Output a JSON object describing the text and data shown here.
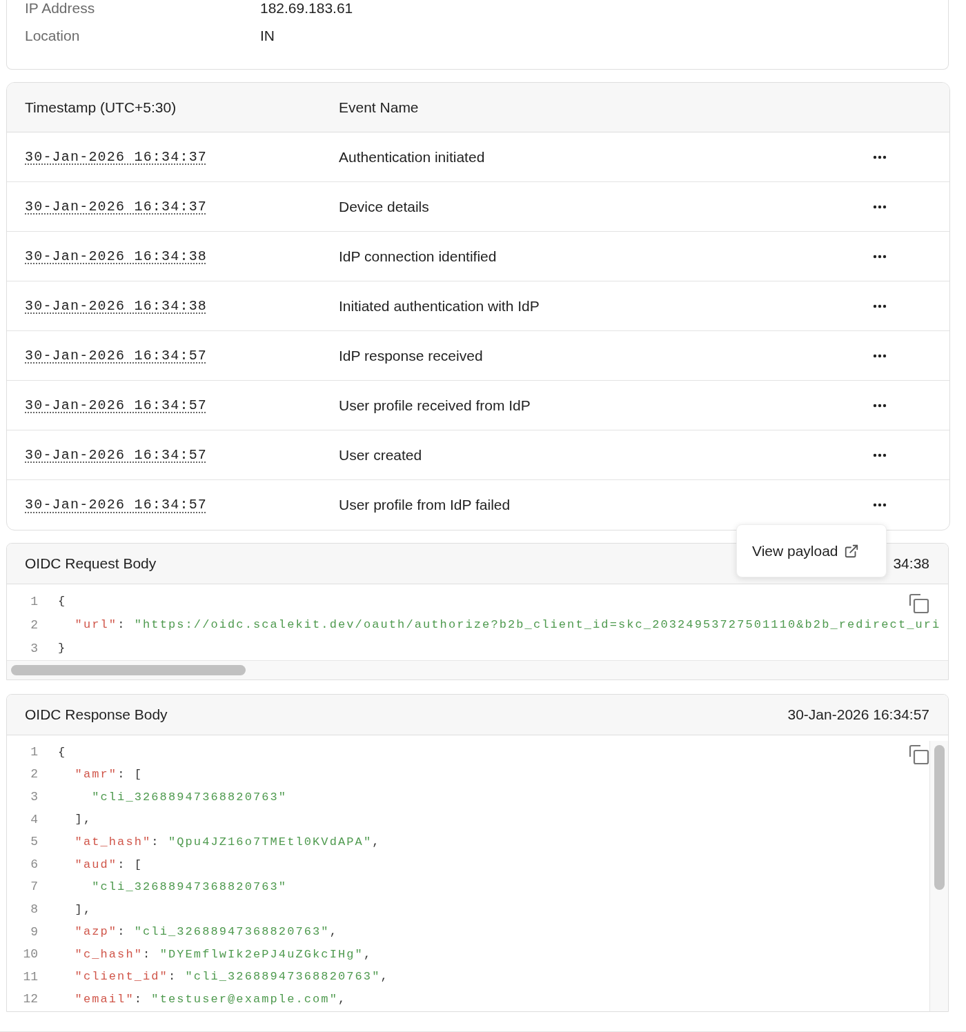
{
  "device_details": {
    "rows": [
      {
        "label": "IP Address",
        "value": "182.69.183.61"
      },
      {
        "label": "Location",
        "value": "IN"
      }
    ]
  },
  "events": {
    "columns": [
      "Timestamp (UTC+5:30)",
      "Event Name"
    ],
    "rows": [
      {
        "timestamp": "30-Jan-2026 16:34:37",
        "event": "Authentication initiated"
      },
      {
        "timestamp": "30-Jan-2026 16:34:37",
        "event": "Device details"
      },
      {
        "timestamp": "30-Jan-2026 16:34:38",
        "event": "IdP connection identified"
      },
      {
        "timestamp": "30-Jan-2026 16:34:38",
        "event": "Initiated authentication with IdP"
      },
      {
        "timestamp": "30-Jan-2026 16:34:57",
        "event": "IdP response received"
      },
      {
        "timestamp": "30-Jan-2026 16:34:57",
        "event": "User profile received from IdP"
      },
      {
        "timestamp": "30-Jan-2026 16:34:57",
        "event": "User created"
      },
      {
        "timestamp": "30-Jan-2026 16:34:57",
        "event": "User profile from IdP failed"
      }
    ]
  },
  "payload_menu": {
    "item": "View payload"
  },
  "request_body": {
    "title": "OIDC Request Body",
    "timestamp": "34:38",
    "lines": [
      {
        "number": "1",
        "tokens": [
          {
            "kind": "punct",
            "text": "{"
          }
        ]
      },
      {
        "number": "2",
        "tokens": [
          {
            "kind": "key",
            "text": "  \"url\""
          },
          {
            "kind": "punct",
            "text": ": "
          },
          {
            "kind": "string",
            "text": "\"https://oidc.scalekit.dev/oauth/authorize?b2b_client_id=skc_20324953727501110&b2b_redirect_uri"
          }
        ]
      },
      {
        "number": "3",
        "tokens": [
          {
            "kind": "punct",
            "text": "}"
          }
        ]
      }
    ]
  },
  "response_body": {
    "title": "OIDC Response Body",
    "timestamp": "30-Jan-2026 16:34:57",
    "lines": [
      {
        "number": "1",
        "tokens": [
          {
            "kind": "punct",
            "text": "{"
          }
        ]
      },
      {
        "number": "2",
        "tokens": [
          {
            "kind": "key",
            "text": "  \"amr\""
          },
          {
            "kind": "punct",
            "text": ": ["
          }
        ]
      },
      {
        "number": "3",
        "tokens": [
          {
            "kind": "string",
            "text": "    \"cli_32688947368820763\""
          }
        ]
      },
      {
        "number": "4",
        "tokens": [
          {
            "kind": "punct",
            "text": "  ],"
          }
        ]
      },
      {
        "number": "5",
        "tokens": [
          {
            "kind": "key",
            "text": "  \"at_hash\""
          },
          {
            "kind": "punct",
            "text": ": "
          },
          {
            "kind": "string",
            "text": "\"Qpu4JZ16o7TMEtl0KVdAPA\""
          },
          {
            "kind": "punct",
            "text": ","
          }
        ]
      },
      {
        "number": "6",
        "tokens": [
          {
            "kind": "key",
            "text": "  \"aud\""
          },
          {
            "kind": "punct",
            "text": ": ["
          }
        ]
      },
      {
        "number": "7",
        "tokens": [
          {
            "kind": "string",
            "text": "    \"cli_32688947368820763\""
          }
        ]
      },
      {
        "number": "8",
        "tokens": [
          {
            "kind": "punct",
            "text": "  ],"
          }
        ]
      },
      {
        "number": "9",
        "tokens": [
          {
            "kind": "key",
            "text": "  \"azp\""
          },
          {
            "kind": "punct",
            "text": ": "
          },
          {
            "kind": "string",
            "text": "\"cli_32688947368820763\""
          },
          {
            "kind": "punct",
            "text": ","
          }
        ]
      },
      {
        "number": "10",
        "tokens": [
          {
            "kind": "key",
            "text": "  \"c_hash\""
          },
          {
            "kind": "punct",
            "text": ": "
          },
          {
            "kind": "string",
            "text": "\"DYEmflwIk2ePJ4uZGkcIHg\""
          },
          {
            "kind": "punct",
            "text": ","
          }
        ]
      },
      {
        "number": "11",
        "tokens": [
          {
            "kind": "key",
            "text": "  \"client_id\""
          },
          {
            "kind": "punct",
            "text": ": "
          },
          {
            "kind": "string",
            "text": "\"cli_32688947368820763\""
          },
          {
            "kind": "punct",
            "text": ","
          }
        ]
      },
      {
        "number": "12",
        "tokens": [
          {
            "kind": "key",
            "text": "  \"email\""
          },
          {
            "kind": "punct",
            "text": ": "
          },
          {
            "kind": "string",
            "text": "\"testuser@example.com\""
          },
          {
            "kind": "punct",
            "text": ","
          }
        ]
      }
    ]
  }
}
